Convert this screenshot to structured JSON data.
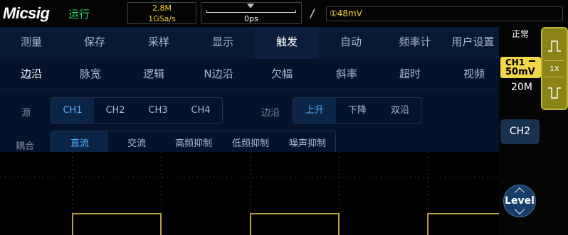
{
  "topbar": {
    "logo": "Micsig",
    "run_state": "运行",
    "memory_depth": "2.8M",
    "sample_rate": "1GSa/s",
    "time_position": "0ps",
    "trigger_slope_symbol": "/",
    "trigger_level": "①48mV"
  },
  "tabs": [
    {
      "label": "测量"
    },
    {
      "label": "保存"
    },
    {
      "label": "采样"
    },
    {
      "label": "显示"
    },
    {
      "label": "触发"
    },
    {
      "label": "自动"
    },
    {
      "label": "频率计"
    },
    {
      "label": "用户设置"
    }
  ],
  "active_tab": "触发",
  "subtabs": [
    {
      "label": "边沿"
    },
    {
      "label": "脉宽"
    },
    {
      "label": "逻辑"
    },
    {
      "label": "N边沿"
    },
    {
      "label": "欠幅"
    },
    {
      "label": "斜率"
    },
    {
      "label": "超时"
    },
    {
      "label": "视频"
    }
  ],
  "active_subtab": "边沿",
  "source": {
    "label": "源",
    "options": [
      "CH1",
      "CH2",
      "CH3",
      "CH4"
    ],
    "selected": "CH1"
  },
  "edge": {
    "label": "边沿",
    "options": [
      "上升",
      "下降",
      "双沿"
    ],
    "selected": "上升"
  },
  "coupling": {
    "label": "耦合",
    "options": [
      "直流",
      "交流",
      "高频抑制",
      "低频抑制",
      "噪声抑制"
    ],
    "selected": "直流"
  },
  "right_panel": {
    "status": "正常",
    "ch1_label": "CH1",
    "ch1_scale": "50mV",
    "timebase": "20M",
    "probe": "1X",
    "ch2_button": "CH2",
    "level_button": "Level"
  },
  "colors": {
    "ch1": "#f0d64a",
    "run": "#2bd16a",
    "selected_option": "#4fb0ff"
  }
}
